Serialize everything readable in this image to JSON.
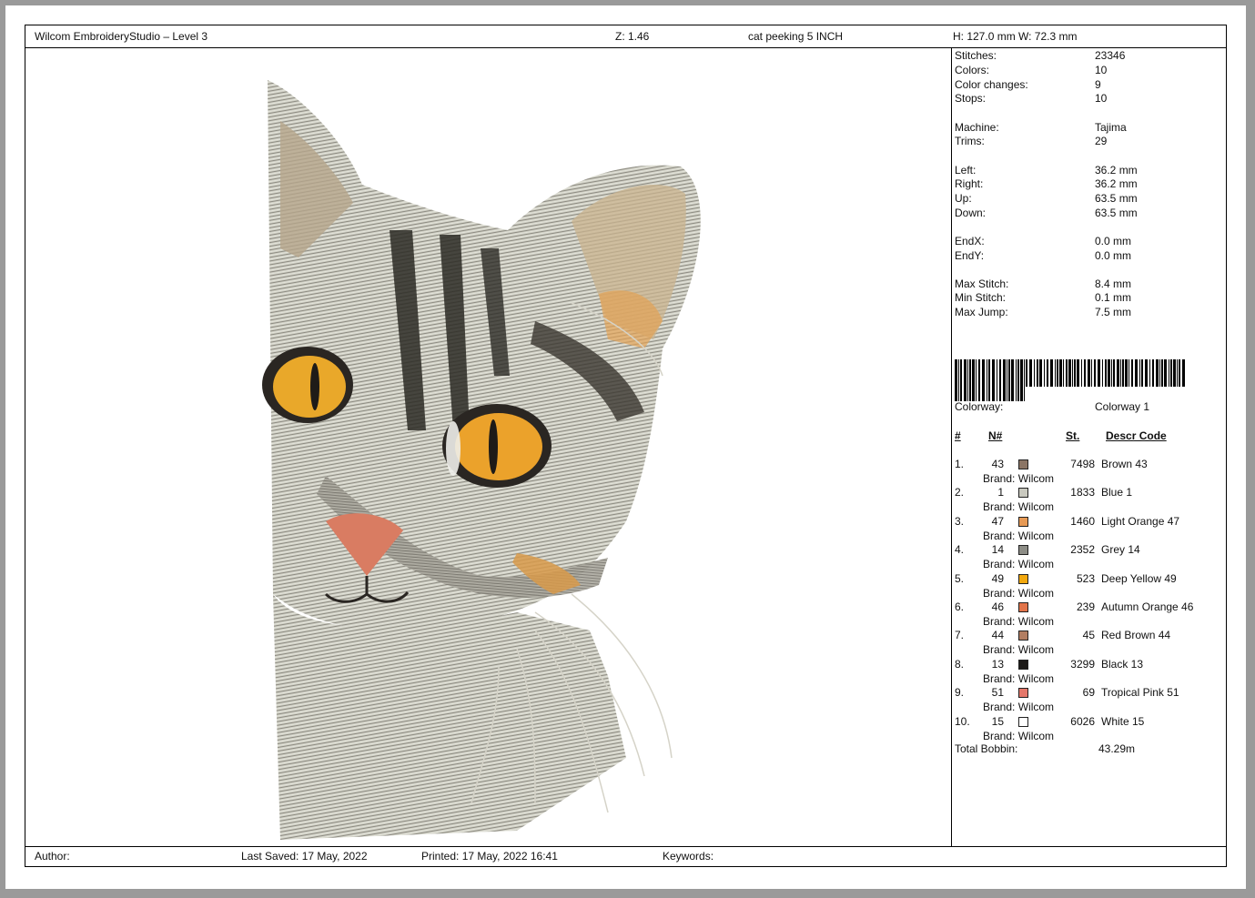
{
  "header": {
    "app_title": "Wilcom EmbroideryStudio – Level 3",
    "zoom": "Z: 1.46",
    "design_name": "cat peeking  5 INCH",
    "dimensions": "H: 127.0 mm   W: 72.3 mm"
  },
  "stats": [
    {
      "label": "Stitches:",
      "value": "23346"
    },
    {
      "label": "Colors:",
      "value": "10"
    },
    {
      "label": "Color changes:",
      "value": "9"
    },
    {
      "label": "Stops:",
      "value": "10"
    },
    {
      "label": "Machine:",
      "value": "Tajima"
    },
    {
      "label": "Trims:",
      "value": "29"
    },
    {
      "label": "Left:",
      "value": "36.2 mm"
    },
    {
      "label": "Right:",
      "value": "36.2 mm"
    },
    {
      "label": "Up:",
      "value": "63.5 mm"
    },
    {
      "label": "Down:",
      "value": "63.5 mm"
    },
    {
      "label": "EndX:",
      "value": "0.0 mm"
    },
    {
      "label": "EndY:",
      "value": "0.0 mm"
    },
    {
      "label": "Max Stitch:",
      "value": "8.4 mm"
    },
    {
      "label": "Min Stitch:",
      "value": "0.1 mm"
    },
    {
      "label": "Max Jump:",
      "value": "7.5 mm"
    }
  ],
  "colorway": {
    "label": "Colorway:",
    "value": "Colorway 1"
  },
  "color_table": {
    "headers": {
      "index": "#",
      "number": "N#",
      "stitches": "St.",
      "description": "Descr  Code"
    },
    "brand_prefix": "Brand: ",
    "rows": [
      {
        "index": "1.",
        "number": "43",
        "color": "#8b7565",
        "stitches": "7498",
        "description": "Brown 43",
        "brand": "Wilcom"
      },
      {
        "index": "2.",
        "number": "1",
        "color": "#c9c9bf",
        "stitches": "1833",
        "description": "Blue 1",
        "brand": "Wilcom"
      },
      {
        "index": "3.",
        "number": "47",
        "color": "#e79a55",
        "stitches": "1460",
        "description": "Light Orange 47",
        "brand": "Wilcom"
      },
      {
        "index": "4.",
        "number": "14",
        "color": "#8d8d86",
        "stitches": "2352",
        "description": "Grey 14",
        "brand": "Wilcom"
      },
      {
        "index": "5.",
        "number": "49",
        "color": "#f2a80e",
        "stitches": "523",
        "description": "Deep Yellow 49",
        "brand": "Wilcom"
      },
      {
        "index": "6.",
        "number": "46",
        "color": "#e2744a",
        "stitches": "239",
        "description": "Autumn Orange 46",
        "brand": "Wilcom"
      },
      {
        "index": "7.",
        "number": "44",
        "color": "#b27e62",
        "stitches": "45",
        "description": "Red Brown 44",
        "brand": "Wilcom"
      },
      {
        "index": "8.",
        "number": "13",
        "color": "#1c1a18",
        "stitches": "3299",
        "description": "Black 13",
        "brand": "Wilcom"
      },
      {
        "index": "9.",
        "number": "51",
        "color": "#e4776a",
        "stitches": "69",
        "description": "Tropical Pink 51",
        "brand": "Wilcom"
      },
      {
        "index": "10.",
        "number": "15",
        "color": "#ffffff",
        "stitches": "6026",
        "description": "White 15",
        "brand": "Wilcom"
      }
    ]
  },
  "total_bobbin": {
    "label": "Total Bobbin:",
    "value": "43.29m"
  },
  "footer": {
    "author": "Author:",
    "last_saved": "Last Saved: 17 May, 2022",
    "printed": "Printed: 17 May, 2022 16:41",
    "keywords": "Keywords:"
  },
  "design": {
    "subject": "embroidered cat peeking"
  }
}
